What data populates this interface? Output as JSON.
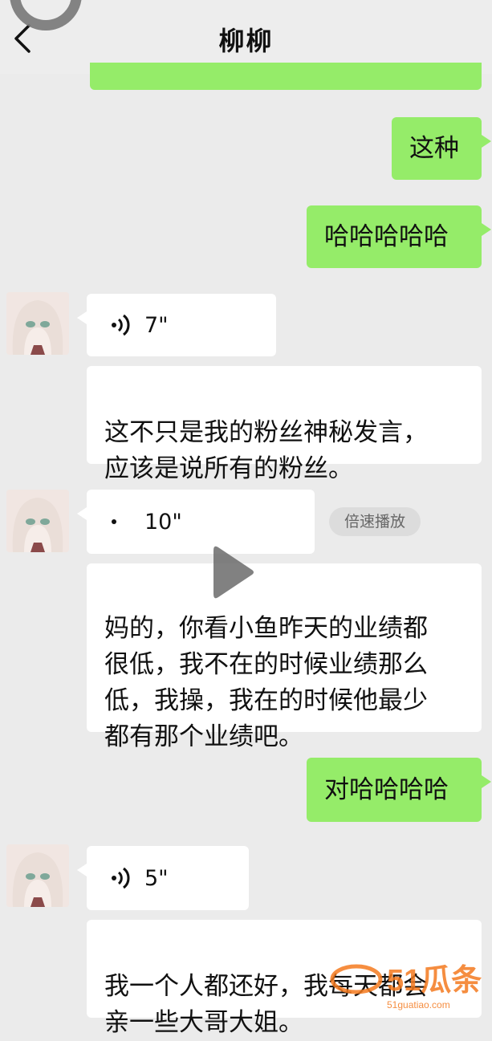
{
  "header": {
    "title": "柳柳",
    "back_icon": "chevron-left-icon"
  },
  "colors": {
    "background": "#ebebeb",
    "sent_bubble": "#95ec69",
    "received_bubble": "#ffffff",
    "watermark_orange": "#f47a1f"
  },
  "messages": {
    "sent_1": "这种",
    "sent_2": "哈哈哈哈哈",
    "voice_1": "7\"",
    "text_1": "这不只是我的粉丝神秘发言，\n应该是说所有的粉丝。",
    "voice_2": "10\"",
    "speed_badge": "倍速播放",
    "text_2": "妈的，你看小鱼昨天的业绩都\n很低，我不在的时候业绩那么\n低，我操，我在的时候他最少\n都有那个业绩吧。",
    "sent_3": "对哈哈哈哈",
    "voice_3": "5\"",
    "text_3": "我一个人都还好，我每天都会\n亲一些大哥大姐。"
  },
  "overlay": {
    "ghost_text": "你看小鱼",
    "play_icon": "play-icon"
  },
  "watermark": {
    "brand": "51瓜条",
    "domain": "51guatiao.com"
  }
}
